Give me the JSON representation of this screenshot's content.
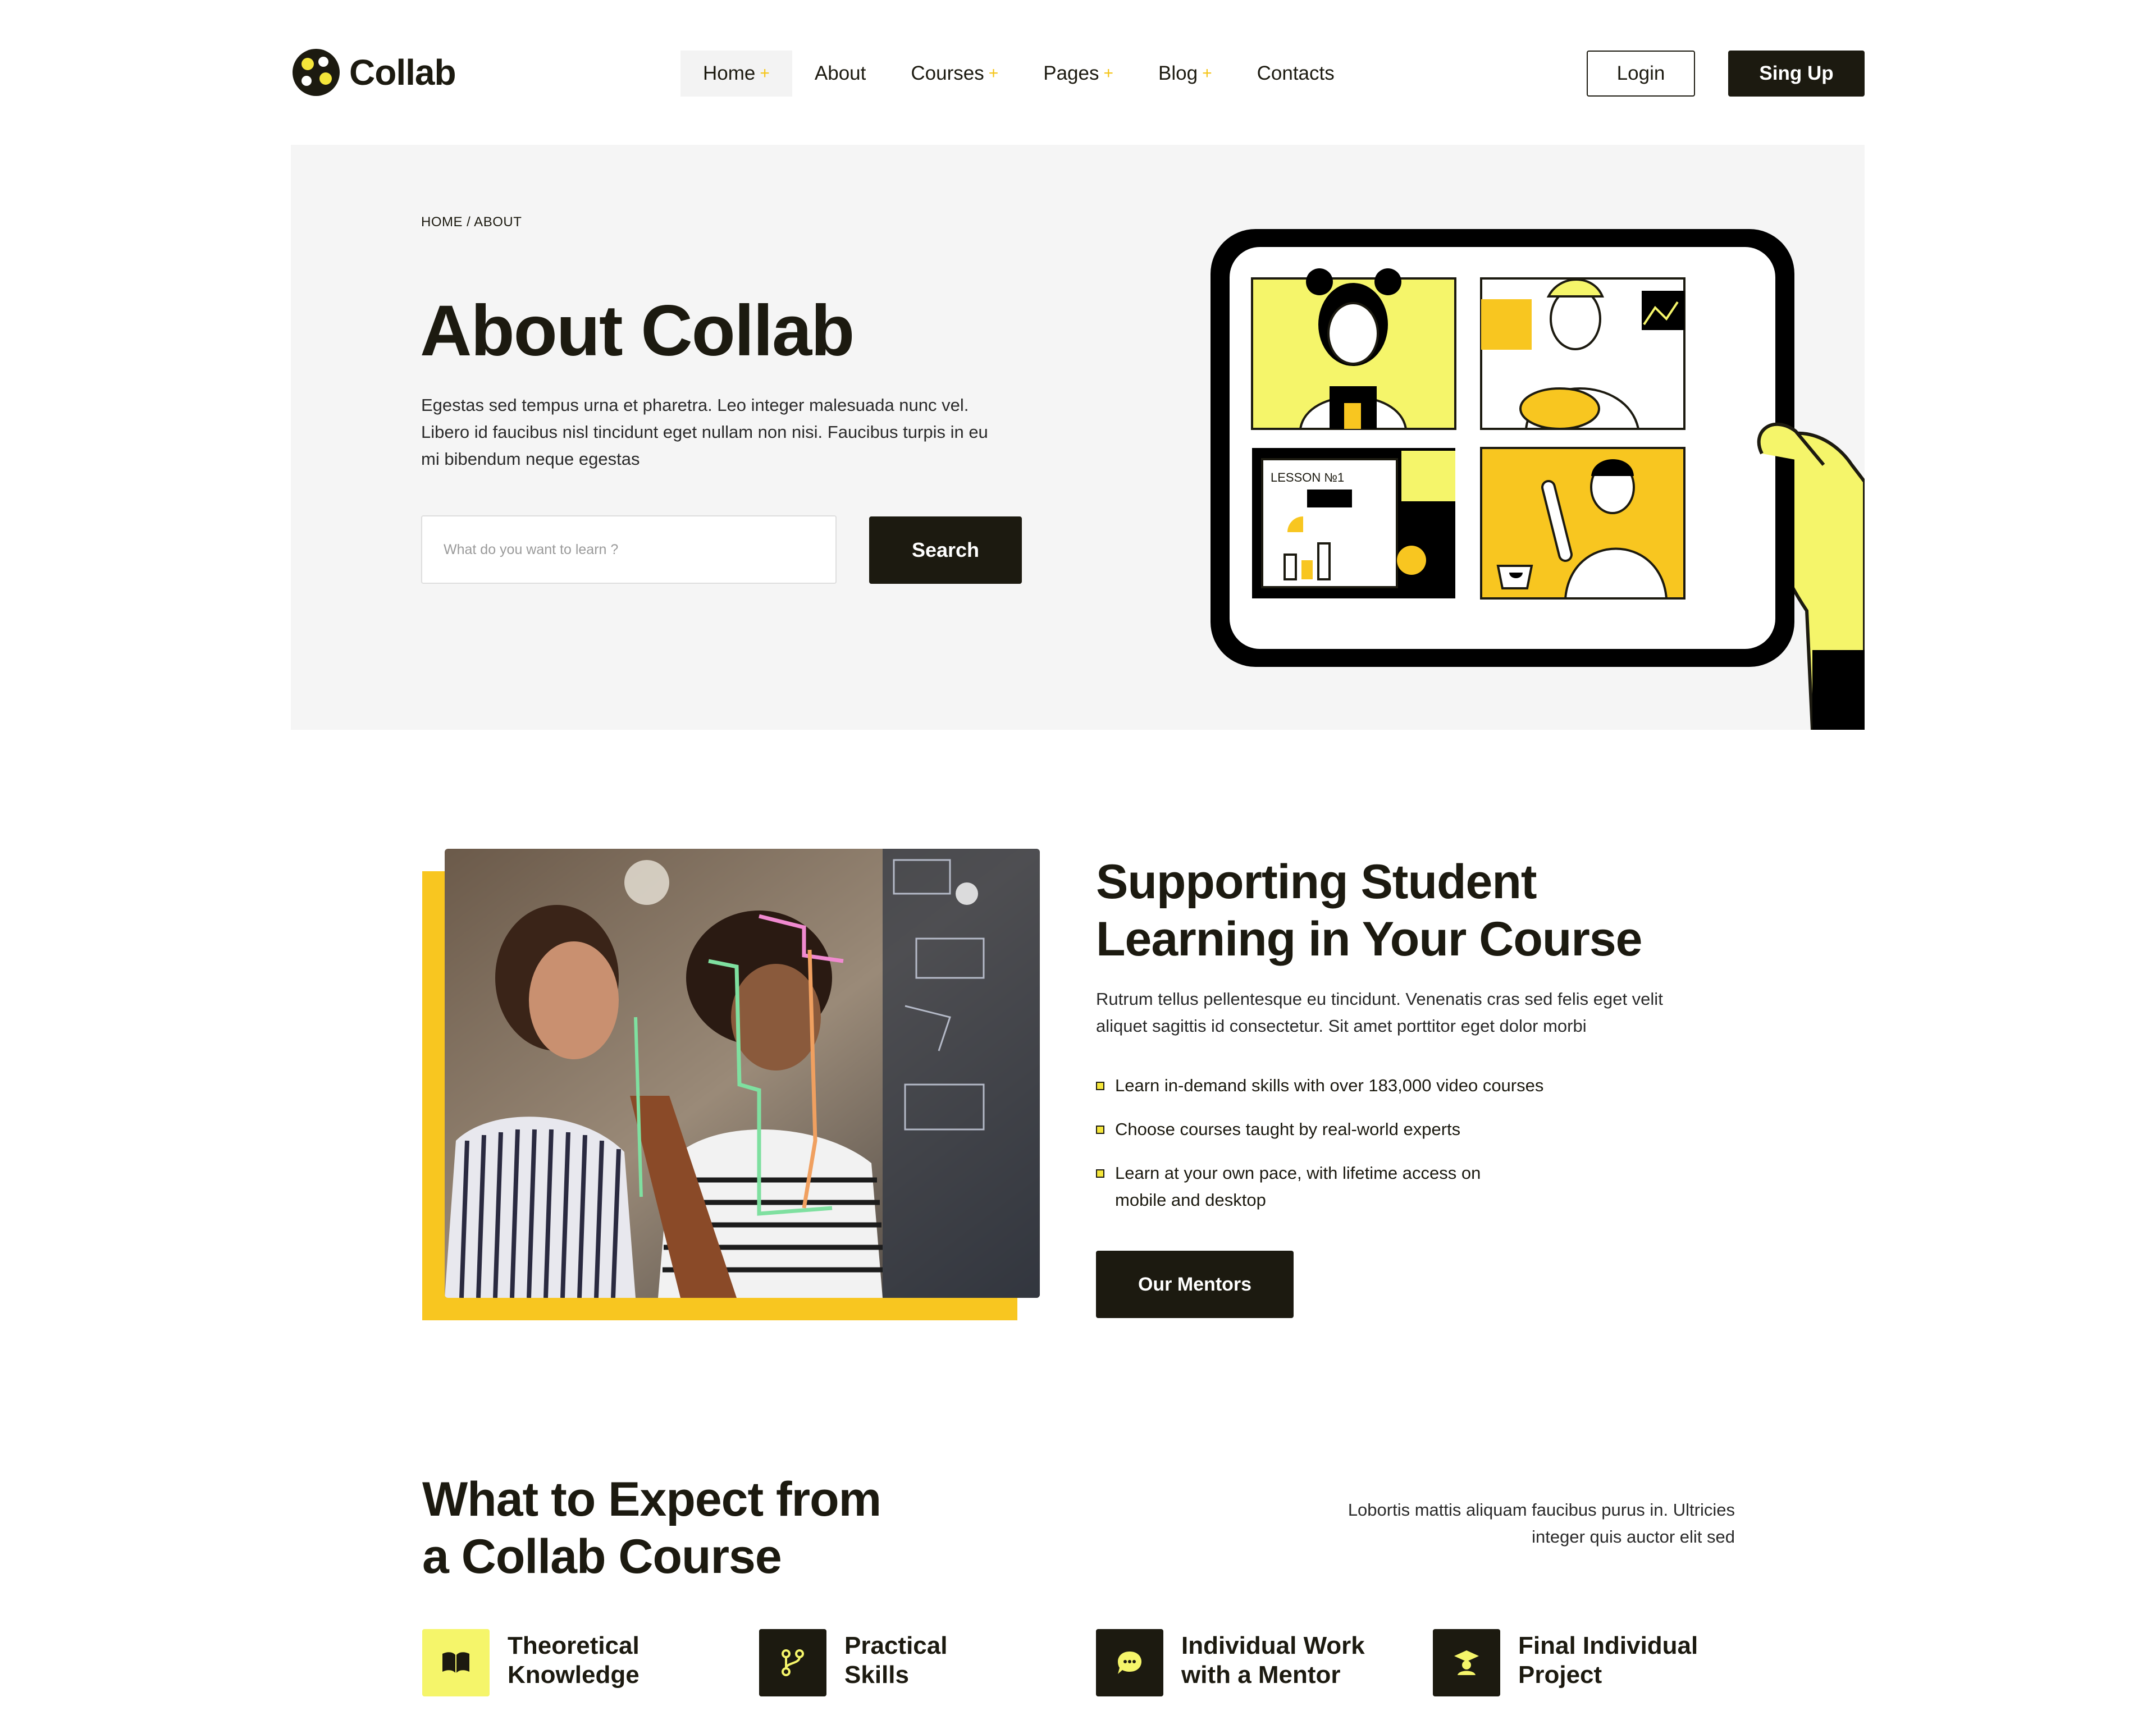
{
  "header": {
    "brand": "Collab",
    "nav": [
      {
        "label": "Home",
        "plus": "+"
      },
      {
        "label": "About",
        "plus": ""
      },
      {
        "label": "Courses",
        "plus": "+"
      },
      {
        "label": "Pages",
        "plus": "+"
      },
      {
        "label": "Blog",
        "plus": "+"
      },
      {
        "label": "Contacts",
        "plus": ""
      }
    ],
    "login_label": "Login",
    "signup_label": "Sing Up"
  },
  "hero": {
    "breadcrumb": "HOME / ABOUT",
    "title": "About Collab",
    "description": "Egestas sed tempus urna et pharetra. Leo integer malesuada nunc vel. Libero id faucibus nisl tincidunt eget nullam non nisi. Faucibus turpis in eu mi bibendum neque egestas",
    "search_placeholder": "What do you want to learn ?",
    "search_label": "Search",
    "illustration_text": "LESSON №1"
  },
  "support": {
    "title_line1": "Supporting Student",
    "title_line2": "Learning in Your Course",
    "description": "Rutrum tellus pellentesque eu tincidunt. Venenatis cras sed felis eget velit aliquet sagittis id consectetur. Sit amet porttitor eget dolor morbi",
    "bullets": [
      "Learn in-demand skills with over 183,000 video courses",
      "Choose courses taught by real-world experts",
      "Learn at your own pace, with lifetime access on mobile and desktop"
    ],
    "button_label": "Our Mentors"
  },
  "expect": {
    "title_line1": "What to Expect from",
    "title_line2": "a Collab Course",
    "description": "Lobortis mattis aliquam faucibus purus in. Ultricies integer quis auctor elit sed",
    "features": [
      {
        "line1": "Theoretical",
        "line2": "Knowledge",
        "icon": "book-icon"
      },
      {
        "line1": "Practical",
        "line2": "Skills",
        "icon": "branch-icon"
      },
      {
        "line1": "Individual Work",
        "line2": "with a Mentor",
        "icon": "chat-icon"
      },
      {
        "line1": "Final Individual",
        "line2": "Project",
        "icon": "graduate-icon"
      }
    ]
  },
  "colors": {
    "accent_yellow": "#f8c620",
    "light_yellow": "#f5f56a",
    "dark": "#1c1a10"
  }
}
